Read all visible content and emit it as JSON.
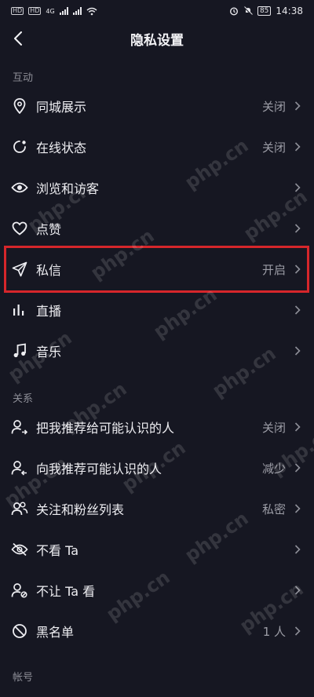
{
  "status_bar": {
    "time": "14:38",
    "battery": "85",
    "sim_tag_1": "HD",
    "sim_tag_2": "HD",
    "net_label": "4G"
  },
  "header": {
    "title": "隐私设置",
    "back_icon": "chevron-left-icon"
  },
  "sections": [
    {
      "label": "互动",
      "items": [
        {
          "label": "同城展示",
          "value": "关闭",
          "icon": "location-pin-icon"
        },
        {
          "label": "在线状态",
          "value": "关闭",
          "icon": "online-status-icon"
        },
        {
          "label": "浏览和访客",
          "value": "",
          "icon": "eye-icon"
        },
        {
          "label": "点赞",
          "value": "",
          "icon": "heart-icon"
        },
        {
          "label": "私信",
          "value": "开启",
          "icon": "send-icon"
        },
        {
          "label": "直播",
          "value": "",
          "icon": "live-bars-icon"
        },
        {
          "label": "音乐",
          "value": "",
          "icon": "music-note-icon"
        }
      ]
    },
    {
      "label": "关系",
      "items": [
        {
          "label": "把我推荐给可能认识的人",
          "value": "关闭",
          "icon": "user-share-icon"
        },
        {
          "label": "向我推荐可能认识的人",
          "value": "减少",
          "icon": "user-recommend-icon"
        },
        {
          "label": "关注和粉丝列表",
          "value": "私密",
          "icon": "users-icon"
        },
        {
          "label": "不看 Ta",
          "value": "",
          "icon": "eye-off-icon"
        },
        {
          "label": "不让 Ta 看",
          "value": "",
          "icon": "user-block-icon"
        },
        {
          "label": "黑名单",
          "value": "1 人",
          "icon": "ban-icon"
        }
      ]
    },
    {
      "label": "帐号",
      "items": []
    }
  ],
  "watermark": "php.cn",
  "colors": {
    "background": "#161722",
    "highlight": "#d6262b",
    "secondary_text": "#9c9da6"
  }
}
